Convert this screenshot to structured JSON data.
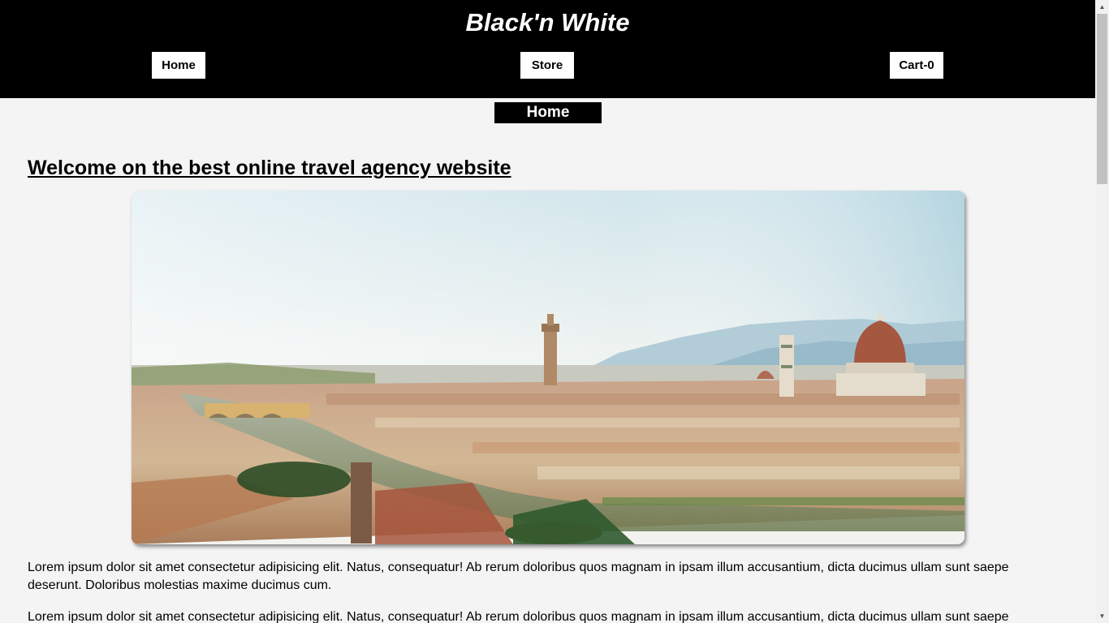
{
  "header": {
    "brand": "Black'n White",
    "nav": {
      "home": "Home",
      "store": "Store",
      "cart": "Cart-0"
    }
  },
  "section": {
    "title": "Home"
  },
  "main": {
    "heading": "Welcome on the best online travel agency website",
    "paragraphs": [
      "Lorem ipsum dolor sit amet consectetur adipisicing elit. Natus, consequatur! Ab rerum doloribus quos magnam in ipsam illum accusantium, dicta ducimus ullam sunt saepe deserunt. Doloribus molestias maxime ducimus cum.",
      "Lorem ipsum dolor sit amet consectetur adipisicing elit. Natus, consequatur! Ab rerum doloribus quos magnam in ipsam illum accusantium, dicta ducimus ullam sunt saepe deserunt. Doloribus molestias maxime ducimus cum."
    ]
  },
  "scrollbar": {
    "up_icon": "▲",
    "down_icon": "▼"
  },
  "colors": {
    "header_bg": "#000000",
    "page_bg": "#f4f4f4",
    "nav_button_bg": "#ffffff"
  }
}
